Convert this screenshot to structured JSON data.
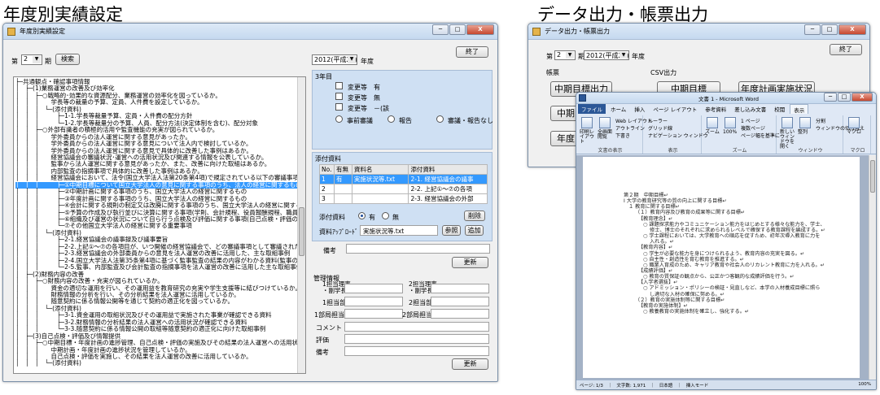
{
  "captions": {
    "left": "年度別実績設定",
    "right": "データ出力・帳票出力"
  },
  "settings_window": {
    "title": "年度別実績設定",
    "min_btn": "─",
    "max_btn": "□",
    "close_btn": "X",
    "period_prefix": "第",
    "period_value": "2",
    "period_suffix": "期",
    "search_btn": "検索",
    "exit_btn": "終了",
    "year_value": "2012(平成24)",
    "year_suffix": "年度",
    "combo_arrow": "▼",
    "tree_lines": [
      "├─共通観点・確認事項情報",
      "│　├─(1)業務運営の改善及び効率化",
      "│　│　├─○戦略的･効果的な資源配分、業務運営の効率化を図っているか。",
      "│　│　│　　学長等の裁量の予算、定員、人件費を設定しているか。",
      "│　│　│　└─(添付資料)",
      "│　│　│　　　├─1-1.学長等裁量予算、定員・人件費の配分方針",
      "│　│　│　　　└─1-2.学長等裁量分の予算、人員、配分方法(決定体制を含む)、配分対象",
      "│　│　├─○外部有識者の積極的活用や監査機能の充実が図られているか。",
      "│　│　│　　学外委員からの法人運営に関する意見があったか。",
      "│　│　│　　学外委員からの法人運営に関する意見について法人内で検討しているか。",
      "│　│　│　　学外委員からの法人運営に関する意見で具体的に改善した事例はあるか。",
      "│　│　│　　経営協議会の審議状況･運営への活用状況及び関連する情報を公表しているか。",
      "│　│　│　　監事から法人運営に関する意見があったか、また、改善に向けた取組はあるか。",
      "│　│　│　　内部監査の指摘事項で具体的に改善した事例はあるか。",
      "│　│　│　　経営協議会において、法令(国立大学法人法第20条第4項)で規定されている以下の審議事項が審議されているか。",
      "│　│　│　　　├─①中期目標について国立大学法人の意見に関する事項のうち、法人の経営に関するもの",
      "│　│　│　　　├─②中期計画に関する事項のうち、国立大学法人の経営に関するもの",
      "│　│　│　　　├─③年度計画に関する事項のうち、国立大学法人の経営に関するもの",
      "│　│　│　　　├─④会計に関する規則の制定又は改廃に関する事項のうち、国立大学法人の経営に関するもの",
      "│　│　│　　　├─⑤予算の作成及び執行並びに決算に関する事項(学則、会計規程、役員報酬規程、職員の給与等の基準)",
      "│　│　│　　　├─⑥組織及び運営の状況について自ら行う点検及び評価に関する事項(自己点検・評価の方针、結果等)",
      "│　│　│　　　└─⑦その他国立大学法人の経営に関する重要事項",
      "│　│　│　└─(添付資料)",
      "│　│　│　　　├─2-1.経営協議会の議事録及び議事要旨",
      "│　│　│　　　├─2-2.上記①～⑦の各項目が、いつ開催の経営協議会で、どの審議事項として審議されたかが確認できる資料",
      "│　│　│　　　├─2-3.経営協議会の外部委員からの意見を法人運営の改善に活用した、主な取組事例",
      "│　│　│　　　├─2-4.国立大学法人法第35条第4項に基づく監事監査の結果の内容がわかる資料(監事の指摘事項等)",
      "│　│　│　　　└─2-5.監事、内部監査及び会計監査の指摘事項を法人運営の改善に活用した主な取組事例",
      "│　├─(2)財務内容の改善",
      "│　│　├─○財務内容の改善・充実が図られているか。",
      "│　│　│　　資金の適切な運用を行い、その運用益を教育研究の充実や学生支援等に結びつけているか。",
      "│　│　│　　財務情報の分析を行い、その分析結果を法人運営に活用しているか。",
      "│　│　│　　随意契約に係る情報公開等を通じて契約の適正化を図っているか。",
      "│　│　│　└─(添付資料)",
      "│　│　│　　　├─3-1.資金運用の取組状況及びその運用益で実施された事業が確認できる資料",
      "│　│　│　　　├─3-2.財務情報の分析結果の法人運営への活用状況が確認できる資料",
      "│　│　│　　　└─3-3.随意契約に係る情報公開の取組等随意契約の適正化に向けた取組事例",
      "│　├─(3)自己点検・評価及び情報提供",
      "│　│　├─○中期目標・年度計画の進捗管理、自己点検・評価の実施及びその結果の法人運営への活用状況",
      "│　│　│　　中期計画・年度計画の進捗状況を管理しているか。",
      "│　│　│　　自己点検・評価を実施し、その結果を法人運営の改善に活用しているか。",
      "│　│　│　└─(添付資料)"
    ],
    "tree_selected_index": 15,
    "panel_title": "3年目",
    "cb_change_yes": "変更等　有",
    "cb_change_no": "変更等　無",
    "cb_change_none": "変更等　－(該",
    "radio_before": "事前審議",
    "radio_report": "報告",
    "radio_both": "審議・報告なし",
    "attach_title": "添付資料",
    "attach_headers": [
      "No.",
      "有無",
      "資料名",
      "添付資料"
    ],
    "attach_rows": [
      [
        "1",
        "有",
        "実施状況等.txt",
        "2-1. 経営協議会の議事"
      ],
      [
        "2",
        "",
        "",
        "2-2. 上記①～⑦の各項"
      ],
      [
        "3",
        "",
        "",
        "2-3. 経営協議会の外部"
      ]
    ],
    "attach_flag_label": "添付資料",
    "attach_yes": "有",
    "attach_no": "無",
    "delete_btn": "削除",
    "upload_label": "資料ｱｯﾌﾟﾛｰﾄﾞ",
    "upload_value": "実施状況等.txt",
    "browse_btn": "参照",
    "add_btn": "追加",
    "memo_label": "備考",
    "update_btn": "更新",
    "mgmt_title": "管理情報",
    "resp1_label": "1担当理事\n・副学長",
    "resp2_label": "2担当理事\n・副学長",
    "dept1_label": "1担当部局",
    "dept2_label": "2担当部局",
    "person1_label": "1部局担当者",
    "person2_label": "2部局担当者",
    "comment_label": "コメント",
    "eval_label": "評価",
    "note_label": "備考",
    "update2_btn": "更新"
  },
  "export_window": {
    "title": "データ出力・帳票出力",
    "min_btn": "─",
    "max_btn": "□",
    "close_btn": "X",
    "period_prefix": "第",
    "period_value": "2",
    "period_suffix": "期",
    "year_value": "2012(平成24)",
    "year_suffix": "年度",
    "exit_btn": "終了",
    "forms_label": "帳票",
    "csv_label": "CSV出力",
    "btn_mid_list": "中期目標出力",
    "btn_mid_partial": "中期",
    "btn_year_partial": "年度",
    "btn_mid_csv": "中期目標",
    "btn_year_plan": "年度計画実施状況"
  },
  "word_window": {
    "title": "文書 1 - Microsoft Word",
    "min_btn": "─",
    "max_btn": "□",
    "close_btn": "X",
    "tabs": [
      "ファイル",
      "ホーム",
      "挿入",
      "ページ レイアウト",
      "参考資料",
      "差し込み文書",
      "校閲",
      "表示"
    ],
    "active_tab_index": 7,
    "groups": [
      {
        "label": "文書の表示",
        "items": [
          "印刷レイアウト",
          "全画面閲覧",
          "Web レイアウト",
          "アウトライン",
          "下書き"
        ]
      },
      {
        "label": "表示",
        "items": [
          "ルーラー",
          "グリッド線",
          "ナビゲーション ウィンドウ"
        ]
      },
      {
        "label": "ズーム",
        "items": [
          "ズーム",
          "100%",
          "1 ページ",
          "複数ページ",
          "ページ幅を基準に"
        ]
      },
      {
        "label": "ウィンドウ",
        "items": [
          "新しいウィンドウを開く",
          "整列",
          "分割",
          "ウィンドウの切り替え"
        ]
      },
      {
        "label": "マクロ",
        "items": [
          "マクロ"
        ]
      }
    ],
    "doc_lines": [
      "第２期　中期目標↵",
      "Ⅰ 大学の教育研究等の質の向上に関する目標↵",
      "１ 教育に関する目標↵",
      "（１）教育内容及び教育の成果等に関する目標↵",
      "【教育理念】↵",
      "○ 課題探求能力やコミュニケーション能力をはじめとする様々な能力を、学士、",
      "修士、博士のそれぞれに求められるレベルで確保する教育課程を編成する。↵",
      "○ 学士課程においては、大学教育への順応を促すため、初年次導入教育に力を",
      "入れる。↵",
      "【教育内容】↵",
      "○ 学生が必要な能力を身につけられるよう、教育内容の充実を図る。↵",
      "○ 自主性・創造性を育む教育を推進する。↵",
      "○ 職業人育成のため、キャリア教育や社会人のリカレント教育に力を入れる。↵",
      "【成績評価】↵",
      "○ 教育の質保証の観点から、公正かつ客観的な成績評価を行う。↵",
      "【入学者選抜】↵",
      "○ アドミッション・ポリシーの検証・見直しなど、本学の入材養成目標に照ら",
      "し適切な入材の確保に努める。↵",
      "（２）教育の実施体制等に関する目標↵",
      "【教育の実施体制】↵",
      "○ 教養教育の実施体制を確立し、強化する。↵"
    ],
    "status": "ページ: 1/3　｜　文字数: 1,971　｜　日本語　｜　挿入モード",
    "zoom": "100%"
  },
  "colors": {
    "selection": "#3399ff",
    "panel_blue": "#cfe0f3",
    "word_file_tab": "#2b5797",
    "window_border": "#7a8fa8"
  }
}
